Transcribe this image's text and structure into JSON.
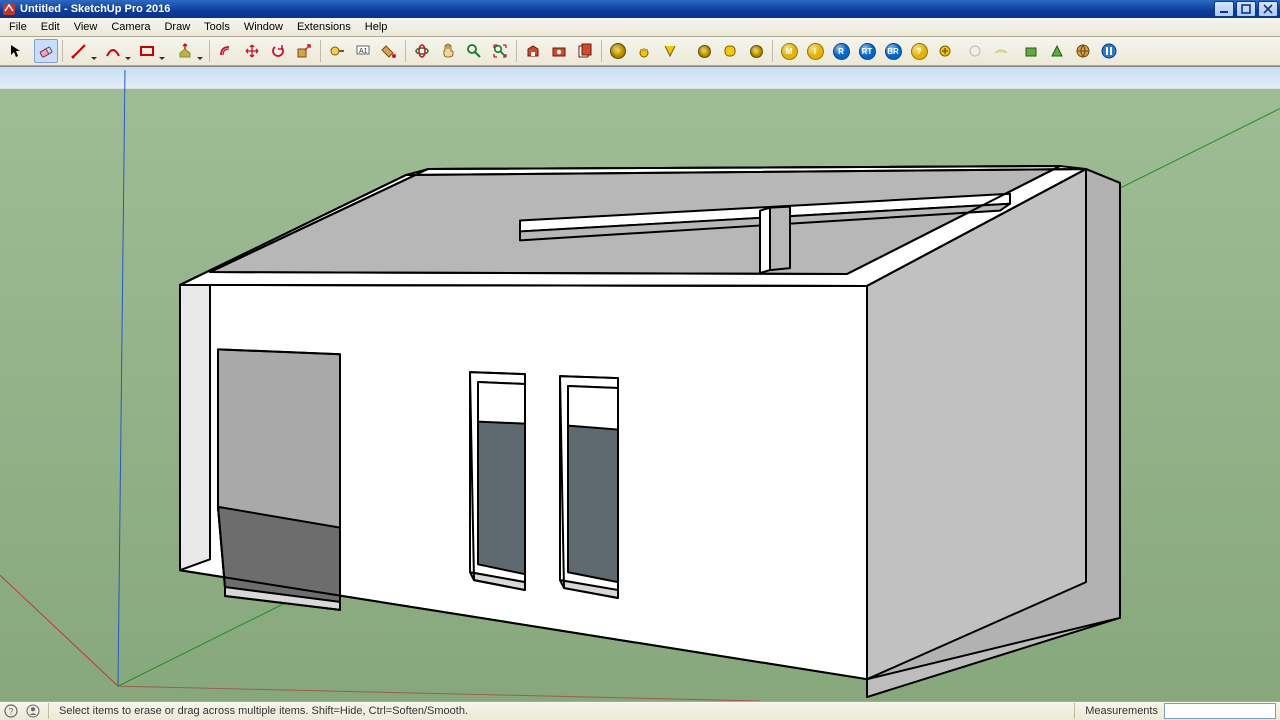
{
  "window": {
    "title": "Untitled - SketchUp Pro 2016"
  },
  "menus": [
    "File",
    "Edit",
    "View",
    "Camera",
    "Draw",
    "Tools",
    "Window",
    "Extensions",
    "Help"
  ],
  "active_tool": "eraser",
  "statusbar": {
    "hint": "Select items to erase or drag across multiple items. Shift=Hide, Ctrl=Soften/Smooth.",
    "measurements_label": "Measurements",
    "measurements_value": ""
  },
  "colors": {
    "sky_top": "#d7e6f4",
    "sky_horizon": "#c9dff2",
    "ground": "#8eac84",
    "ground_far": "#9dba92",
    "model_face_light": "#ffffff",
    "model_face_dark": "#b0b0b0",
    "model_edge": "#000000",
    "axis_red": "#c0392b",
    "axis_green": "#1e8f1e",
    "axis_blue": "#2659c7"
  }
}
